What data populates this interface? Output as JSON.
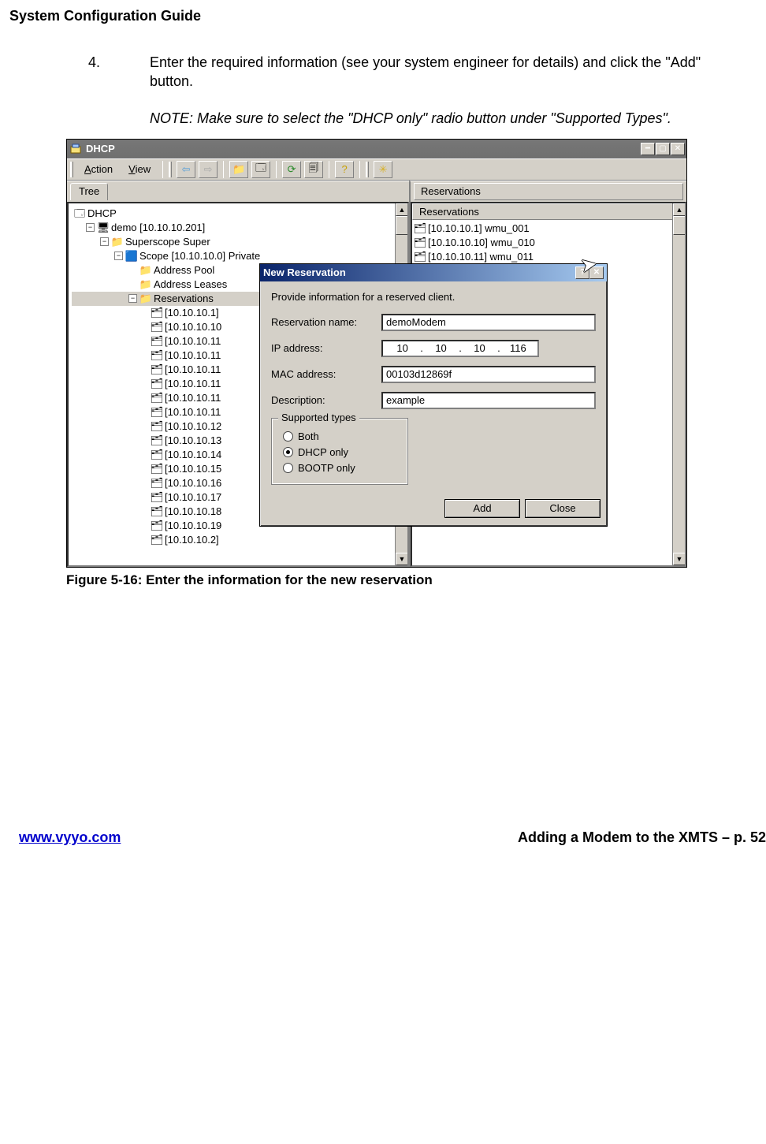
{
  "doc_title": "System Configuration Guide",
  "step_number": "4.",
  "step_text": "Enter the required information (see your system engineer for details) and click the \"Add\" button.",
  "note_text": "NOTE: Make sure to select the \"DHCP only\" radio button under  \"Supported Types\".",
  "figure_caption": "Figure 5-16: Enter the information for the new reservation",
  "footer_url": "www.vyyo.com",
  "footer_right": "Adding a Modem to the XMTS – p. 52",
  "app": {
    "title": "DHCP",
    "menu_action": "Action",
    "menu_view": "View",
    "tree_tab": "Tree",
    "right_header": "Reservations",
    "right_column": "Reservations",
    "tree": {
      "root": "DHCP",
      "server": "demo [10.10.10.201]",
      "superscope": "Superscope Super",
      "scope": "Scope [10.10.10.0] Private",
      "sub1": "Address Pool",
      "sub2": "Address Leases",
      "sub3": "Reservations",
      "res": [
        "[10.10.10.1]",
        "[10.10.10.10",
        "[10.10.10.11",
        "[10.10.10.11",
        "[10.10.10.11",
        "[10.10.10.11",
        "[10.10.10.11",
        "[10.10.10.11",
        "[10.10.10.12",
        "[10.10.10.13",
        "[10.10.10.14",
        "[10.10.10.15",
        "[10.10.10.16",
        "[10.10.10.17",
        "[10.10.10.18",
        "[10.10.10.19",
        "[10.10.10.2]"
      ]
    },
    "right_list": [
      "[10.10.10.1] wmu_001",
      "[10.10.10.10] wmu_010",
      "[10.10.10.11] wmu_011"
    ]
  },
  "dialog": {
    "title": "New Reservation",
    "desc": "Provide information for a reserved client.",
    "lbl_name": "Reservation name:",
    "lbl_ip": "IP address:",
    "lbl_mac": "MAC address:",
    "lbl_desc": "Description:",
    "val_name": "demoModem",
    "ip": {
      "a": "10",
      "b": "10",
      "c": "10",
      "d": "116"
    },
    "val_mac": "00103d12869f",
    "val_desc": "example",
    "groupbox": "Supported types",
    "radio_both": "Both",
    "radio_dhcp": "DHCP only",
    "radio_bootp": "BOOTP only",
    "btn_add": "Add",
    "btn_close": "Close"
  }
}
